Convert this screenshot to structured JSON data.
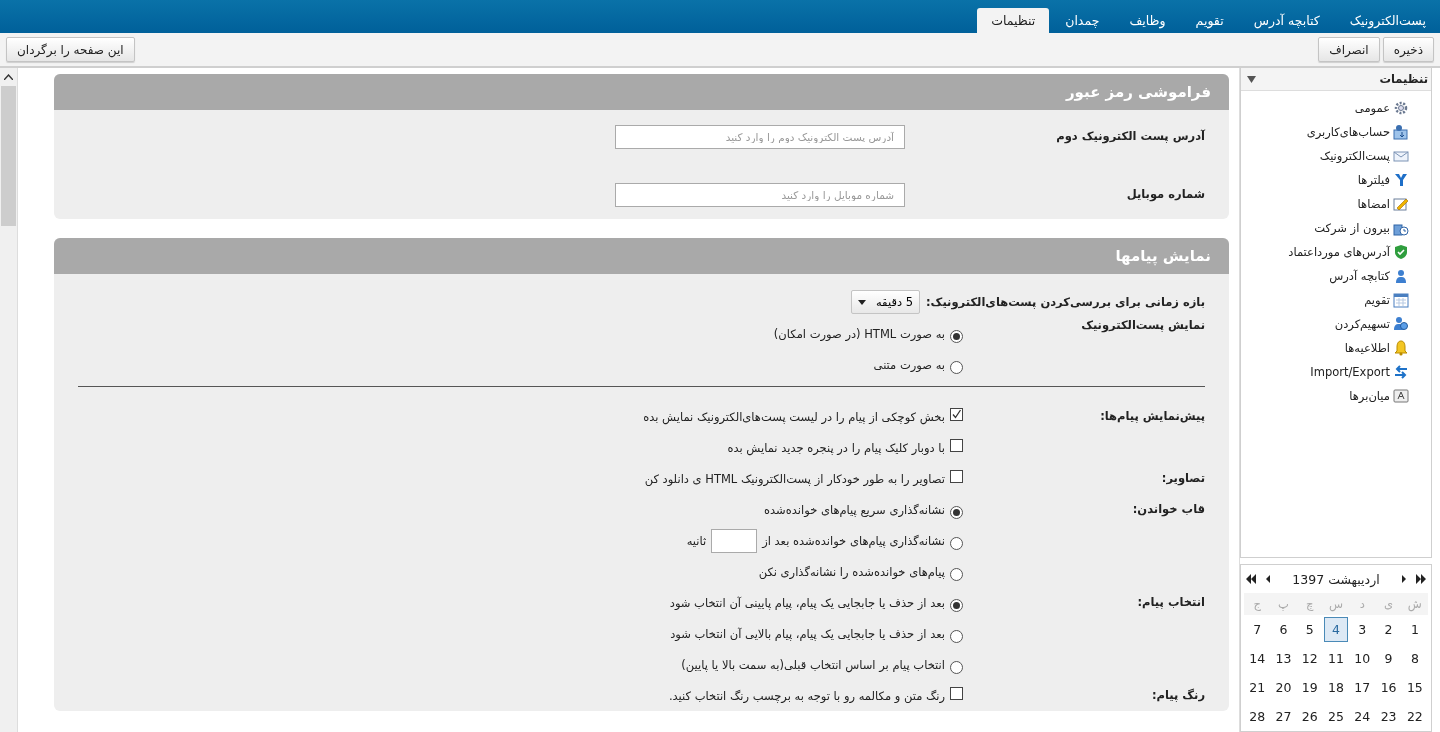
{
  "tabs": [
    {
      "label": "پست‌الکترونیک",
      "selected": false
    },
    {
      "label": "کتابچه آدرس",
      "selected": false
    },
    {
      "label": "تقویم",
      "selected": false
    },
    {
      "label": "وظایف",
      "selected": false
    },
    {
      "label": "چمدان",
      "selected": false
    },
    {
      "label": "تنظیمات",
      "selected": true
    }
  ],
  "toolbar": {
    "actions": [
      "ذخیره",
      "انصراف"
    ],
    "revert": "این صفحه را برگردان"
  },
  "sections": [
    {
      "title": "فراموشی رمز عبور",
      "kind": "fields",
      "rows": [
        {
          "label": "آدرس پست الکترونیک دوم",
          "placeholder": "آدرس پست الکترونیک دوم را وارد کنید"
        },
        {
          "label": "شماره موبایل",
          "placeholder": "شماره موبایل را وارد کنید"
        }
      ]
    },
    {
      "title": "نمایش پیامها",
      "kind": "options",
      "interval": {
        "label": "بازه زمانی برای بررسی‌کردن پست‌های‌الکترونیک:",
        "value": "5 دقیقه"
      },
      "groups": [
        {
          "label": "نمایش پست‌الکترونیک",
          "divider_after": true,
          "options": [
            {
              "kind": "radio",
              "label": "به صورت HTML (در صورت امکان)",
              "selected": true
            },
            {
              "kind": "radio",
              "label": "به صورت متنی",
              "selected": false
            }
          ]
        },
        {
          "label": "پیش‌نمایش پیام‌ها:",
          "divider_after": false,
          "options": [
            {
              "kind": "checkbox",
              "label": "بخش کوچکی از پیام را در لیست پست‌های‌الکترونیک نمایش بده",
              "checked": true
            },
            {
              "kind": "checkbox",
              "label": "با دوبار کلیک پیام را در پنجره جدید نمایش بده",
              "checked": false
            }
          ]
        },
        {
          "label": "تصاویر:",
          "divider_after": false,
          "options": [
            {
              "kind": "checkbox",
              "label": "تصاویر را به طور خودکار از پست‌الکترونیک HTML ی دانلود کن",
              "checked": false
            }
          ]
        },
        {
          "label": "قاب خواندن:",
          "divider_after": false,
          "options": [
            {
              "kind": "radio",
              "label": "نشانه‌گذاری سریع پیام‌های خوانده‌شده",
              "selected": true
            },
            {
              "kind": "radio_field",
              "label": "نشانه‌گذاری پیام‌های خوانده‌شده بعد از",
              "suffix": "ثانیه",
              "selected": false
            },
            {
              "kind": "radio",
              "label": "پیام‌های خوانده‌شده را نشانه‌گذاری نکن",
              "selected": false
            }
          ]
        },
        {
          "label": "انتخاب پیام:",
          "divider_after": false,
          "options": [
            {
              "kind": "radio",
              "label": "بعد از حذف یا جابجایی یک پیام، پیام پایینی آن انتخاب شود",
              "selected": true
            },
            {
              "kind": "radio",
              "label": "بعد از حذف یا جابجایی یک پیام، پیام بالایی آن انتخاب شود",
              "selected": false
            },
            {
              "kind": "radio",
              "label": "انتخاب پیام بر اساس انتخاب قبلی(به سمت بالا یا پایین)",
              "selected": false
            }
          ]
        },
        {
          "label": "رنگ پیام:",
          "divider_after": false,
          "options": [
            {
              "kind": "checkbox",
              "label": "رنگ متن و مکالمه رو با توجه به برچسب رنگ انتخاب کنید.",
              "checked": false
            }
          ]
        }
      ]
    }
  ],
  "sidebar": {
    "title": "تنظیمات",
    "items": [
      "عمومی",
      "حساب‌های‌کاربری",
      "پست‌الکترونیک",
      "فیلترها",
      "امضاها",
      "بیرون از شرکت",
      "آدرس‌های مورداعتماد",
      "کتابچه آدرس",
      "تقویم",
      "تسهیم‌کردن",
      "اطلاعیه‌ها",
      "Import/Export",
      "میان‌برها"
    ]
  },
  "calendar": {
    "month": "اردیبهشت 1397",
    "weekdays": [
      "ش",
      "ی",
      "د",
      "س",
      "چ",
      "پ",
      "ج"
    ],
    "weeks": [
      [
        {
          "day": "1",
          "selected": false
        },
        {
          "day": "2",
          "selected": false
        },
        {
          "day": "3",
          "selected": false
        },
        {
          "day": "4",
          "selected": true
        },
        {
          "day": "5",
          "selected": false
        },
        {
          "day": "6",
          "selected": false
        },
        {
          "day": "7",
          "selected": false
        }
      ],
      [
        {
          "day": "8",
          "selected": false
        },
        {
          "day": "9",
          "selected": false
        },
        {
          "day": "10",
          "selected": false
        },
        {
          "day": "11",
          "selected": false
        },
        {
          "day": "12",
          "selected": false
        },
        {
          "day": "13",
          "selected": false
        },
        {
          "day": "14",
          "selected": false
        }
      ],
      [
        {
          "day": "15",
          "selected": false
        },
        {
          "day": "16",
          "selected": false
        },
        {
          "day": "17",
          "selected": false
        },
        {
          "day": "18",
          "selected": false
        },
        {
          "day": "19",
          "selected": false
        },
        {
          "day": "20",
          "selected": false
        },
        {
          "day": "21",
          "selected": false
        }
      ],
      [
        {
          "day": "22",
          "selected": false
        },
        {
          "day": "23",
          "selected": false
        },
        {
          "day": "24",
          "selected": false
        },
        {
          "day": "25",
          "selected": false
        },
        {
          "day": "26",
          "selected": false
        },
        {
          "day": "27",
          "selected": false
        },
        {
          "day": "28",
          "selected": false
        }
      ]
    ]
  }
}
